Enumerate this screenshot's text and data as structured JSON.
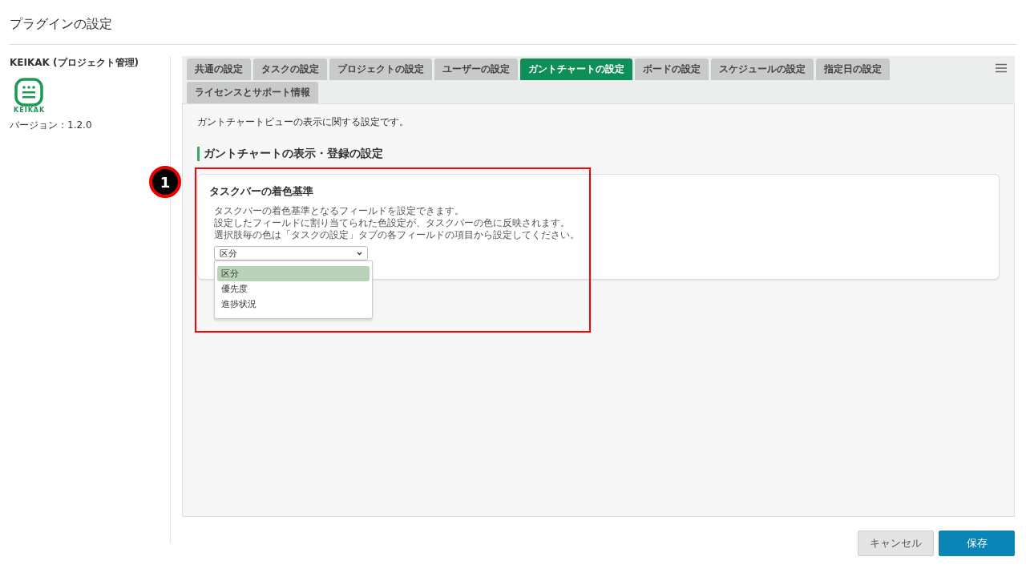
{
  "page_title": "プラグインの設定",
  "plugin": {
    "name": "KEIKAK (プロジェクト管理)",
    "logo_text": "KEIKAK",
    "version": "バージョン：1.2.0"
  },
  "tabs": [
    {
      "label": "共通の設定",
      "selected": false
    },
    {
      "label": "タスクの設定",
      "selected": false
    },
    {
      "label": "プロジェクトの設定",
      "selected": false
    },
    {
      "label": "ユーザーの設定",
      "selected": false
    },
    {
      "label": "ガントチャートの設定",
      "selected": true
    },
    {
      "label": "ボードの設定",
      "selected": false
    },
    {
      "label": "スケジュールの設定",
      "selected": false
    },
    {
      "label": "指定日の設定",
      "selected": false
    },
    {
      "label": "ライセンスとサポート情報",
      "selected": false
    }
  ],
  "panel": {
    "description": "ガントチャートビューの表示に関する設定です。",
    "section_title": "ガントチャートの表示・登録の設定",
    "card": {
      "title": "タスクバーの着色基準",
      "help": [
        "タスクバーの着色基準となるフィールドを設定できます。",
        "設定したフィールドに割り当てられた色設定が、タスクバーの色に反映されます。",
        "選択肢毎の色は「タスクの設定」タブの各フィールドの項目から設定してください。"
      ],
      "select": {
        "value": "区分",
        "expanded": true,
        "options": [
          {
            "label": "区分",
            "selected": true
          },
          {
            "label": "優先度",
            "selected": false
          },
          {
            "label": "進捗状況",
            "selected": false
          }
        ]
      }
    }
  },
  "callout": {
    "number": "1"
  },
  "buttons": [
    {
      "kind": "secondary",
      "label": "キャンセル"
    },
    {
      "kind": "primary",
      "label": "保存"
    }
  ]
}
